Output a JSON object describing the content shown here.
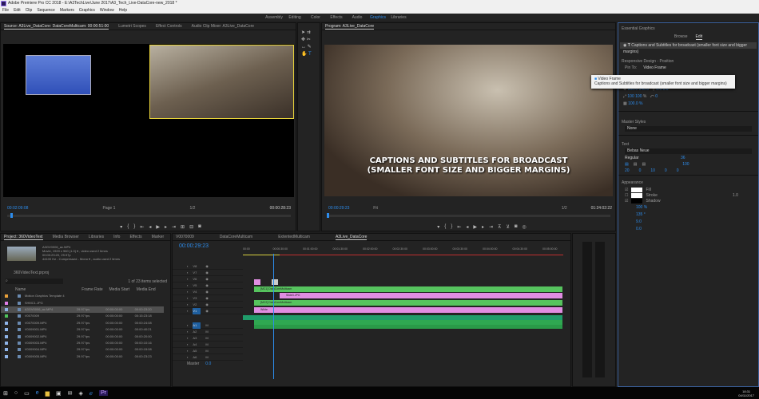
{
  "window": {
    "title": "Adobe Premiere Pro CC 2018 - E:\\A3TechLive\\June 2017\\A3_Tech_Live-DataCore-new_2018 *"
  },
  "menu": [
    "File",
    "Edit",
    "Clip",
    "Sequence",
    "Markers",
    "Graphics",
    "Window",
    "Help"
  ],
  "workspaces": [
    "Assembly",
    "Editing",
    "Color",
    "Effects",
    "Audio",
    "Graphics",
    "Libraries"
  ],
  "active_workspace": "Graphics",
  "source": {
    "tabs": [
      "Source: A3Live_DataCore: DataCoreMulticam: 00:00:51:00",
      "Lumetri Scopes",
      "Effect Controls",
      "Audio Clip Mixer: A3Live_DataCore"
    ],
    "timecode": "00:02:09:08",
    "page": "Page 1",
    "zoom": "1/2",
    "duration": "00:00:28:23",
    "ruler_start": "0",
    "ruler_end": "0"
  },
  "program": {
    "tab": "Program: A3Live_DataCore",
    "timecode": "00:00:29:23",
    "fit": "Fit",
    "zoom": "1/2",
    "duration": "01:24:02:22",
    "caption_line1": "CAPTIONS AND SUBTITLES FOR BROADCAST",
    "caption_line2": "(SMALLER FONT SIZE AND BIGGER MARGINS)"
  },
  "essential_graphics": {
    "title": "Essential Graphics",
    "tabs": [
      "Browse",
      "Edit"
    ],
    "active_tab": "Edit",
    "layer": "Captions and Subtitles for broadcast (smaller font size and bigger margins)",
    "responsive_label": "Responsive Design - Position",
    "pin_to_label": "Pin To:",
    "pin_to_value": "Video Frame",
    "dropdown_options": [
      "Video Frame",
      "Captions and Subtitles for broadcast (smaller font size and bigger margins)"
    ],
    "position": [
      "960.0",
      "540.0"
    ],
    "anchor": [
      "0.0",
      "0.0"
    ],
    "scale": "100",
    "scale2": "100",
    "rotation": "0",
    "opacity": "100.0 %",
    "master_styles_label": "Master Styles",
    "master_style": "None",
    "text_label": "Text",
    "font": "Bebas Neue",
    "font_style": "Regular",
    "font_size": "36",
    "tracking": "20",
    "kerning": "0",
    "leading": "10",
    "baseline": "0",
    "tsume": "0",
    "align_value": "100",
    "appearance_label": "Appearance",
    "fill_label": "Fill",
    "stroke_label": "Stroke",
    "stroke_value": "1.0",
    "shadow_label": "Shadow",
    "shadow_opacity": "100 %",
    "shadow_angle": "135 °",
    "shadow_distance": "9.0",
    "shadow_size": "0.0"
  },
  "project": {
    "tabs": [
      "Project: 360VideoText",
      "Media Browser",
      "Libraries",
      "Info",
      "Effects",
      "Marker"
    ],
    "preview_info": [
      "A3GV0006_ac.MP4",
      "Movie, 1920 x 960 (1.0)  ▾  , video used 2 times",
      "00:00:23:20, 29.97p",
      "44100 Hz - Compressed - Mono  ▾  , audio used 2 times"
    ],
    "project_file": "360VideoText.prproj",
    "selection": "1 of 23 items selected",
    "columns": [
      "Name",
      "Frame Rate",
      "Media Start",
      "Media End"
    ],
    "items": [
      {
        "color": "#e8a03a",
        "name": "Motion Graphics Template 4",
        "rate": "",
        "start": "",
        "end": ""
      },
      {
        "color": "#e07ee8",
        "name": "SHMC1.JPG",
        "rate": "",
        "start": "",
        "end": ""
      },
      {
        "color": "#8fb4e8",
        "name": "A3GV0006_ac.MP4",
        "rate": "29.97 fps",
        "start": "00:00:00:00",
        "end": "00:00:23:20"
      },
      {
        "color": "#4ec25a",
        "name": "V0070009",
        "rate": "29.97 fps",
        "start": "00:00:00:00",
        "end": "00:15:23:18"
      },
      {
        "color": "#8fb4e8",
        "name": "V0070009.MP4",
        "rate": "29.97 fps",
        "start": "00:00:00:00",
        "end": "00:00:24:08"
      },
      {
        "color": "#8fb4e8",
        "name": "V0009001.MP4",
        "rate": "29.97 fps",
        "start": "00:00:00:00",
        "end": "00:00:40:21"
      },
      {
        "color": "#8fb4e8",
        "name": "V0009002.MP4",
        "rate": "29.97 fps",
        "start": "00:00:00:00",
        "end": "00:00:20:00"
      },
      {
        "color": "#8fb4e8",
        "name": "V0009003.MP4",
        "rate": "29.97 fps",
        "start": "00:00:00:00",
        "end": "00:00:10:16"
      },
      {
        "color": "#8fb4e8",
        "name": "V0009004.MP4",
        "rate": "29.97 fps",
        "start": "00:00:00:00",
        "end": "00:00:15:08"
      },
      {
        "color": "#8fb4e8",
        "name": "V0009005.MP4",
        "rate": "29.97 fps",
        "start": "00:00:00:00",
        "end": "00:00:23:23"
      }
    ]
  },
  "timeline": {
    "tabs": [
      "V0070009",
      "DataCoreMulticam",
      "ExtentedMulticam",
      "A3Live_DataCore"
    ],
    "active_tab": "A3Live_DataCore",
    "timecode": "00:00:29:23",
    "ruler": [
      "00:00",
      "00:00:30:00",
      "00:01:00:00",
      "00:01:30:00",
      "00:02:00:00",
      "00:02:30:00",
      "00:03:00:00",
      "00:03:30:00",
      "00:04:00:00",
      "00:04:30:00",
      "00:05:00:00"
    ],
    "tracks": [
      "V8",
      "V7",
      "V6",
      "V5",
      "V4",
      "V3",
      "V2",
      "V1",
      "A1",
      "A2",
      "A3",
      "A4",
      "A5",
      "A6"
    ],
    "master": "Master",
    "master_value": "0.0",
    "clip_multicam": "[MC1] DataCoreMulticam",
    "clip_multicam2": "[MC2] DataCoreMulticam",
    "clip_jpg": "Slide3.JPG",
    "clip_white": "White"
  },
  "taskbar": {
    "time": "18:31",
    "date": "04/11/2017"
  }
}
